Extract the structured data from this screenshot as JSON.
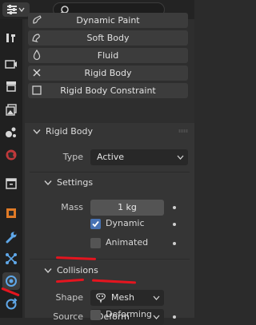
{
  "physics_buttons": {
    "dynamic_paint": "Dynamic Paint",
    "soft_body": "Soft Body",
    "fluid": "Fluid",
    "rigid_body": "Rigid Body",
    "rigid_body_constraint": "Rigid Body Constraint"
  },
  "rigid_body_panel": {
    "title": "Rigid Body",
    "type_label": "Type",
    "type_value": "Active",
    "settings": {
      "title": "Settings",
      "mass_label": "Mass",
      "mass_value": "1 kg",
      "dynamic_label": "Dynamic",
      "dynamic_checked": true,
      "animated_label": "Animated",
      "animated_checked": false
    },
    "collisions": {
      "title": "Collisions",
      "shape_label": "Shape",
      "shape_value": "Mesh",
      "source_label": "Source",
      "source_value": "Deform",
      "deforming_label": "Deforming",
      "deforming_checked": false
    }
  },
  "colors": {
    "accent": "#4772b3",
    "annotation": "#e4151f",
    "physics_tab": "#3d8ad6"
  }
}
